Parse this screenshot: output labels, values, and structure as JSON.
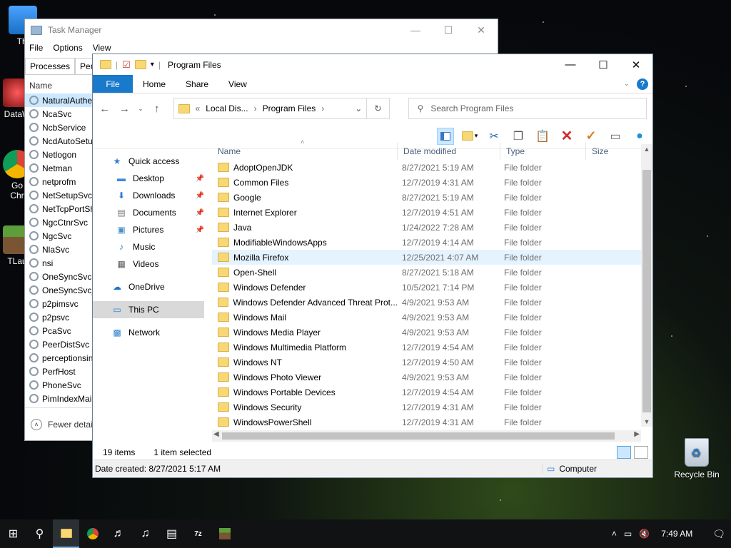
{
  "desktop": {
    "icons": [
      {
        "label": "Thi",
        "icon": "pc-icon"
      },
      {
        "label": "DataW",
        "icon": "app-icon"
      },
      {
        "label": "Go\nChr",
        "icon": "chrome-icon"
      },
      {
        "label": "TLau",
        "icon": "minecraft-icon"
      }
    ],
    "recycle_bin": "Recycle Bin"
  },
  "task_manager": {
    "title": "Task Manager",
    "menu": [
      "File",
      "Options",
      "View"
    ],
    "tabs": [
      "Processes",
      "Perfo"
    ],
    "column_name": "Name",
    "services": [
      "NaturalAuthe",
      "NcaSvc",
      "NcbService",
      "NcdAutoSetu",
      "Netlogon",
      "Netman",
      "netprofm",
      "NetSetupSvc",
      "NetTcpPortSh",
      "NgcCtnrSvc",
      "NgcSvc",
      "NlaSvc",
      "nsi",
      "OneSyncSvc",
      "OneSyncSvc_",
      "p2pimsvc",
      "p2psvc",
      "PcaSvc",
      "PeerDistSvc",
      "perceptionsin",
      "PerfHost",
      "PhoneSvc",
      "PimIndexMai"
    ],
    "fewer_details": "Fewer detai"
  },
  "explorer": {
    "title": "Program Files",
    "ribbon_tabs": [
      "File",
      "Home",
      "Share",
      "View"
    ],
    "address": {
      "prefix": "«",
      "parts": [
        "Local Dis...",
        "Program Files"
      ]
    },
    "search_placeholder": "Search Program Files",
    "nav": {
      "quick_access": "Quick access",
      "pinned": [
        "Desktop",
        "Downloads",
        "Documents",
        "Pictures"
      ],
      "unpinned": [
        "Music",
        "Videos"
      ],
      "onedrive": "OneDrive",
      "this_pc": "This PC",
      "network": "Network"
    },
    "columns": [
      "Name",
      "Date modified",
      "Type",
      "Size"
    ],
    "files": [
      {
        "name": "AdoptOpenJDK",
        "date": "8/27/2021 5:19 AM",
        "type": "File folder"
      },
      {
        "name": "Common Files",
        "date": "12/7/2019 4:31 AM",
        "type": "File folder"
      },
      {
        "name": "Google",
        "date": "8/27/2021 5:19 AM",
        "type": "File folder"
      },
      {
        "name": "Internet Explorer",
        "date": "12/7/2019 4:51 AM",
        "type": "File folder"
      },
      {
        "name": "Java",
        "date": "1/24/2022 7:28 AM",
        "type": "File folder"
      },
      {
        "name": "ModifiableWindowsApps",
        "date": "12/7/2019 4:14 AM",
        "type": "File folder"
      },
      {
        "name": "Mozilla Firefox",
        "date": "12/25/2021 4:07 AM",
        "type": "File folder",
        "hover": true
      },
      {
        "name": "Open-Shell",
        "date": "8/27/2021 5:18 AM",
        "type": "File folder"
      },
      {
        "name": "Windows Defender",
        "date": "10/5/2021 7:14 PM",
        "type": "File folder"
      },
      {
        "name": "Windows Defender Advanced Threat Prot...",
        "date": "4/9/2021 9:53 AM",
        "type": "File folder"
      },
      {
        "name": "Windows Mail",
        "date": "4/9/2021 9:53 AM",
        "type": "File folder"
      },
      {
        "name": "Windows Media Player",
        "date": "4/9/2021 9:53 AM",
        "type": "File folder"
      },
      {
        "name": "Windows Multimedia Platform",
        "date": "12/7/2019 4:54 AM",
        "type": "File folder"
      },
      {
        "name": "Windows NT",
        "date": "12/7/2019 4:50 AM",
        "type": "File folder"
      },
      {
        "name": "Windows Photo Viewer",
        "date": "4/9/2021 9:53 AM",
        "type": "File folder"
      },
      {
        "name": "Windows Portable Devices",
        "date": "12/7/2019 4:54 AM",
        "type": "File folder"
      },
      {
        "name": "Windows Security",
        "date": "12/7/2019 4:31 AM",
        "type": "File folder"
      },
      {
        "name": "WindowsPowerShell",
        "date": "12/7/2019 4:31 AM",
        "type": "File folder"
      }
    ],
    "status": {
      "count": "19 items",
      "selected": "1 item selected"
    },
    "info": {
      "date_created": "Date created: 8/27/2021 5:17 AM",
      "computer": "Computer"
    }
  },
  "taskbar": {
    "clock": "7:49 AM"
  }
}
